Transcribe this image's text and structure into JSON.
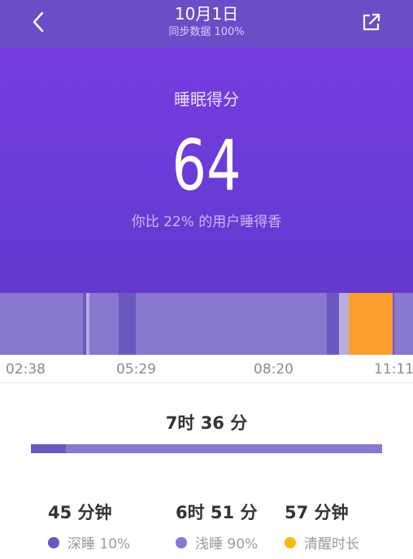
{
  "header": {
    "title": "10月1日",
    "subtitle": "同步数据 100%"
  },
  "hero": {
    "label": "睡眠得分",
    "score": "64",
    "compare": "你比 22% 的用户睡得香"
  },
  "timeline": {
    "ticks": [
      "02:38",
      "05:29",
      "08:20",
      "11:11"
    ]
  },
  "summary": {
    "total": "7时 36 分",
    "deep_ratio": 0.1,
    "light_ratio": 0.9,
    "stats": [
      {
        "value": "45 分钟",
        "legend": "深睡 10%"
      },
      {
        "value": "6时 51 分",
        "legend": "浅睡 90%"
      },
      {
        "value": "57 分钟",
        "legend": "清醒时长"
      }
    ]
  },
  "colors": {
    "header": "#6a4ec8",
    "hero": "#763de0",
    "deep": "#6a58c0",
    "light": "#8878cf",
    "awake": "#fb9d2e",
    "dark_text": "#333333",
    "muted_text": "#9a9a9a"
  },
  "icons": {
    "back": "back-icon",
    "share": "share-icon"
  }
}
